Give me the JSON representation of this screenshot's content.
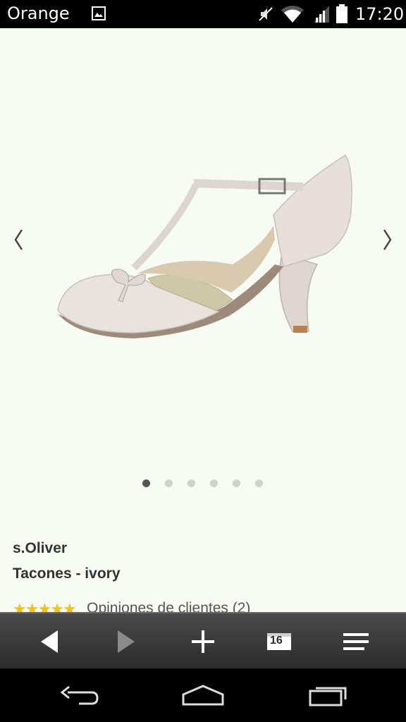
{
  "status_bar": {
    "carrier": "Orange",
    "time": "17:20",
    "icons": [
      "gallery-icon",
      "mute-icon",
      "wifi-icon",
      "signal-icon",
      "battery-icon"
    ]
  },
  "product": {
    "brand": "s.Oliver",
    "name": "Tacones - ivory",
    "rating_stars": 5,
    "reviews_label": "Opiniones de clientes (2)",
    "image_carousel": {
      "total": 6,
      "active_index": 0
    }
  },
  "toolbar": {
    "tab_count": "16",
    "icons": [
      "back-icon",
      "forward-icon",
      "new-tab-icon",
      "tabs-icon",
      "menu-icon"
    ]
  },
  "navbar": {
    "icons": [
      "back-nav-icon",
      "home-nav-icon",
      "recents-nav-icon"
    ]
  },
  "colors": {
    "page_bg": "#f6fbf3",
    "star": "#f1c40f",
    "dot_active": "#555555",
    "dot_inactive": "#cfd3cd"
  }
}
